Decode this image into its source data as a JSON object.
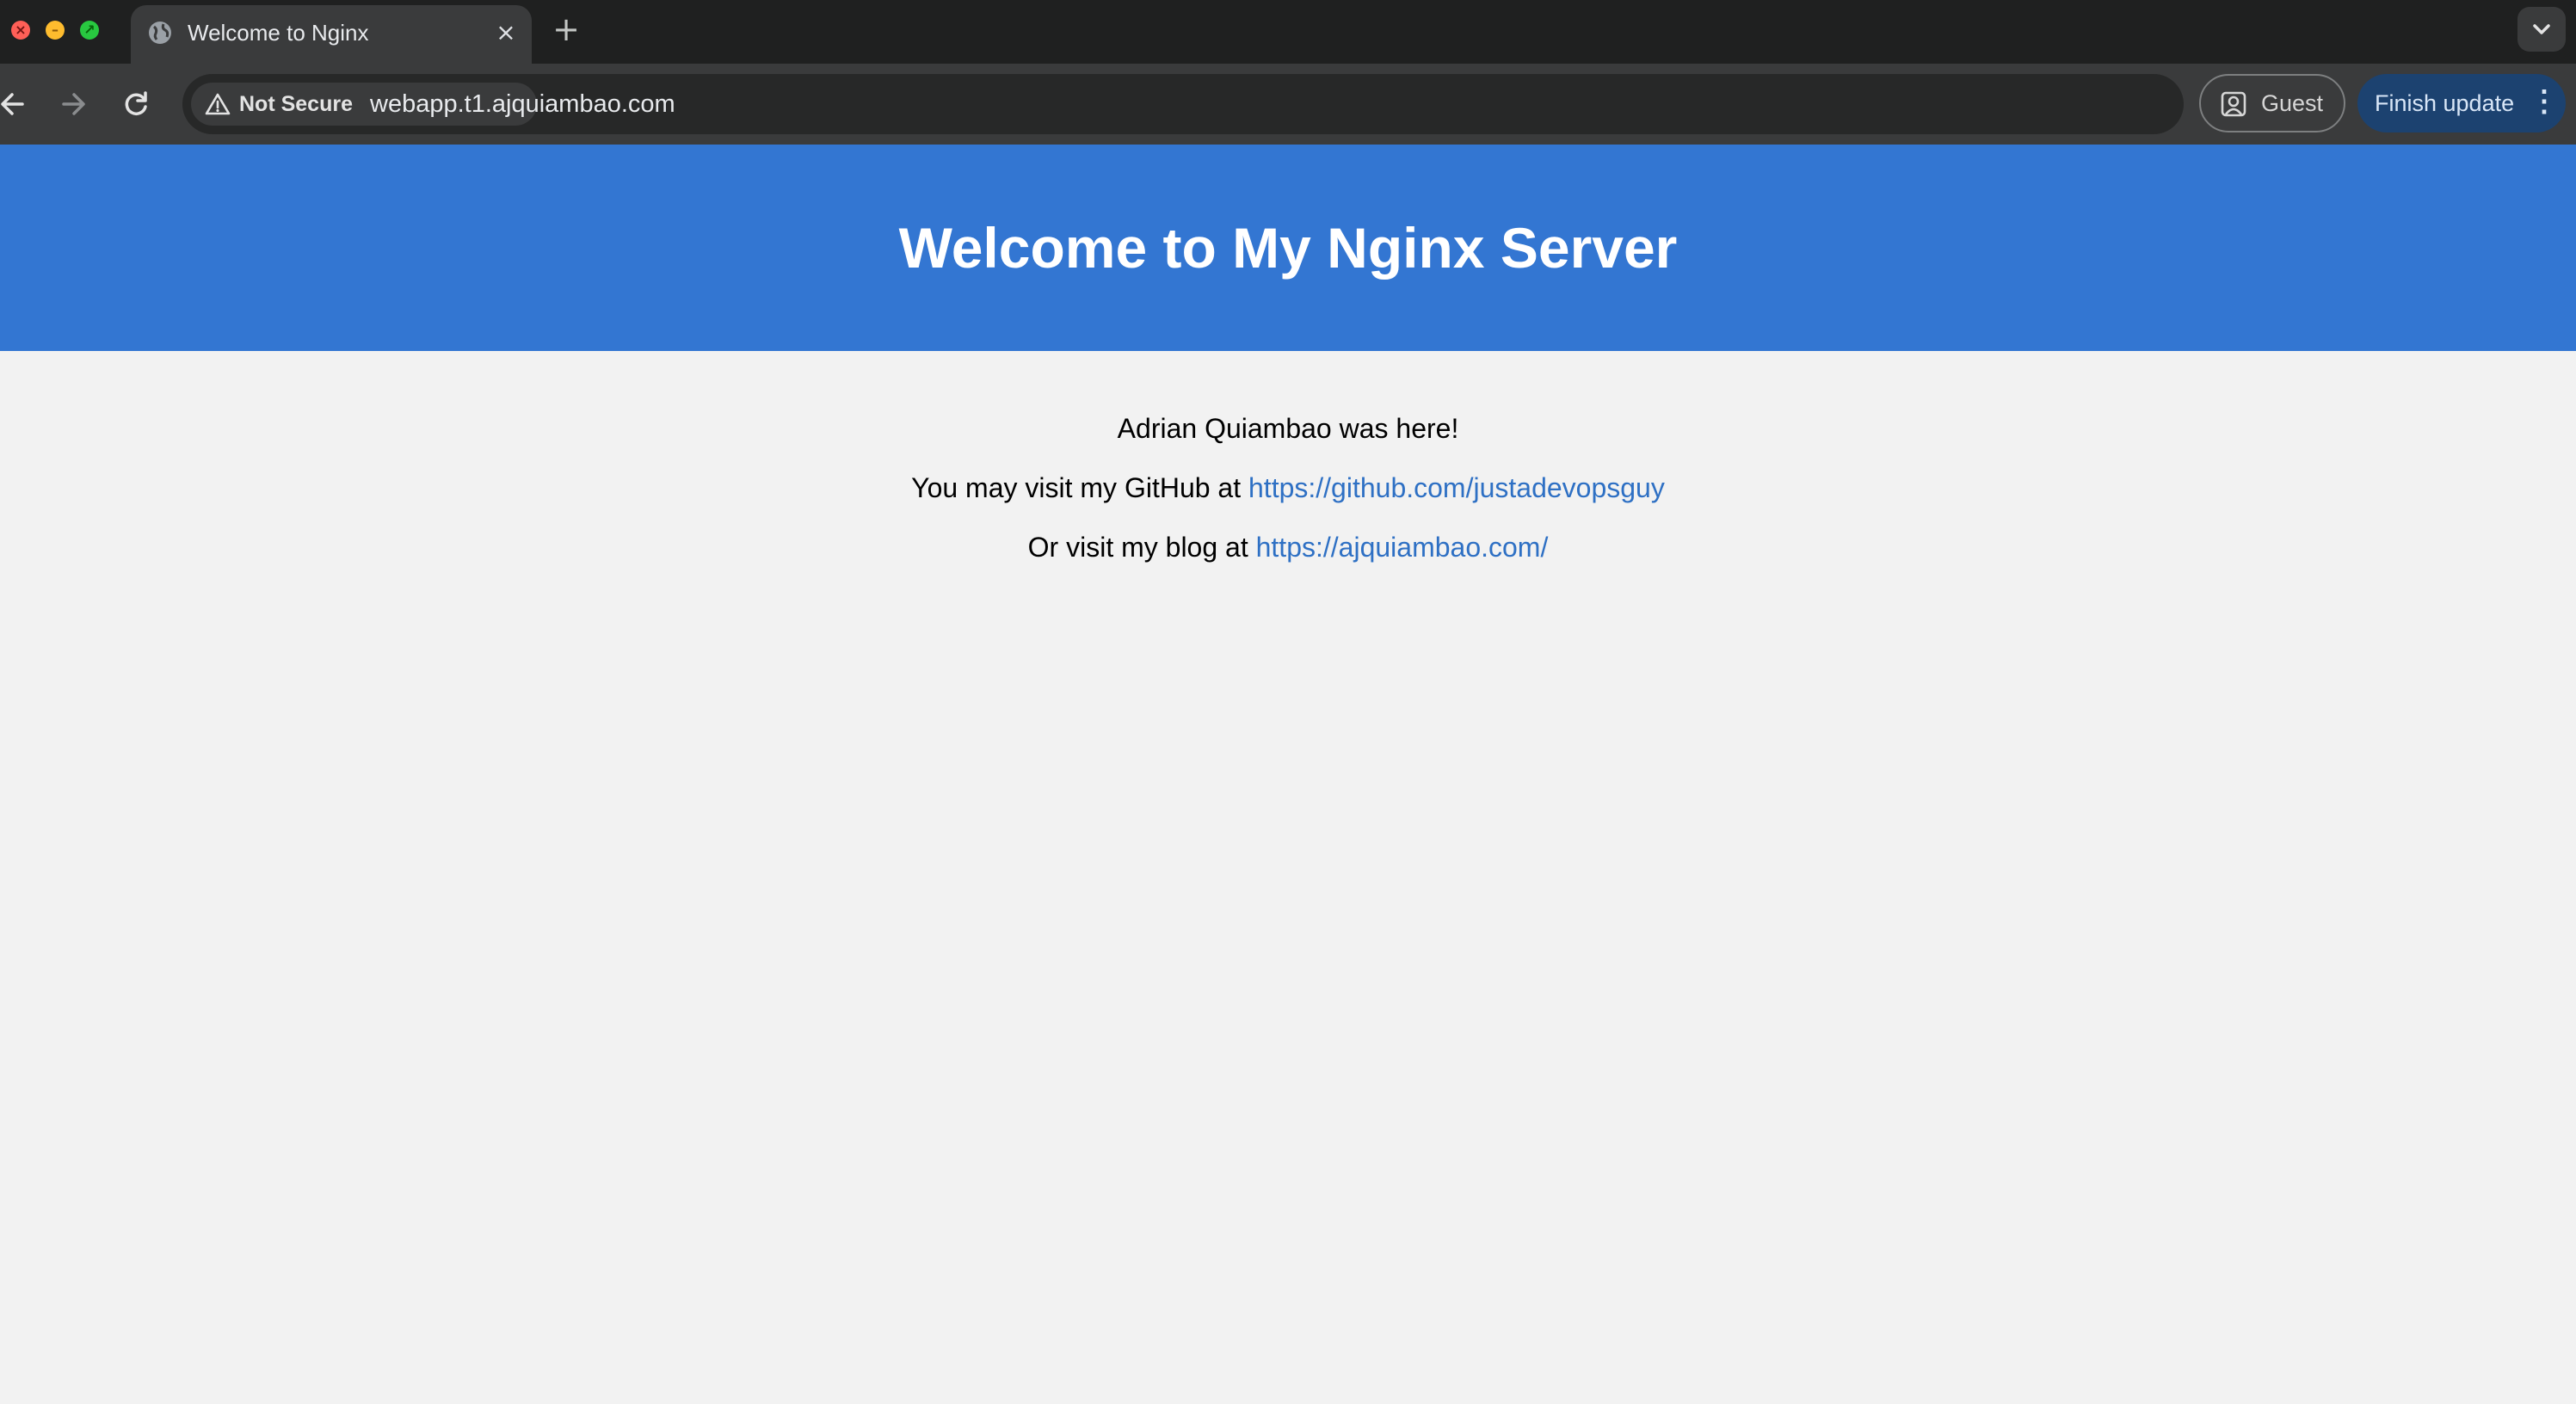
{
  "tab": {
    "title": "Welcome to Nginx"
  },
  "toolbar": {
    "security_label": "Not Secure",
    "url": "webapp.t1.ajquiambao.com",
    "guest_label": "Guest",
    "update_label": "Finish update"
  },
  "page": {
    "heading": "Welcome to My Nginx Server",
    "line1": "Adrian Quiambao was here!",
    "line2_prefix": "You may visit my GitHub at ",
    "line2_link": "https://github.com/justadevopsguy",
    "line3_prefix": "Or visit my blog at ",
    "line3_link": "https://ajquiambao.com/"
  },
  "colors": {
    "header_bg": "#3376d2",
    "page_bg": "#f2f2f2",
    "link": "#2e70c4"
  }
}
